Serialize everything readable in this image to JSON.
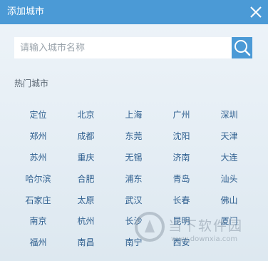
{
  "window": {
    "title": "添加城市"
  },
  "search": {
    "placeholder": "请输入城市名称"
  },
  "hot_cities": {
    "title": "热门城市",
    "cities": [
      "定位",
      "北京",
      "上海",
      "广州",
      "深圳",
      "郑州",
      "成都",
      "东莞",
      "沈阳",
      "天津",
      "苏州",
      "重庆",
      "无锡",
      "济南",
      "大连",
      "哈尔滨",
      "合肥",
      "浦东",
      "青岛",
      "汕头",
      "石家庄",
      "太原",
      "武汉",
      "长春",
      "佛山",
      "南京",
      "杭州",
      "长沙",
      "昆明",
      "厦门",
      "福州",
      "南昌",
      "南宁",
      "西安"
    ]
  },
  "watermark": {
    "brand": "当下软件园",
    "url": "www.downxia.com"
  },
  "colors": {
    "accent": "#4b9ad6",
    "city_text": "#2f5f8f"
  }
}
